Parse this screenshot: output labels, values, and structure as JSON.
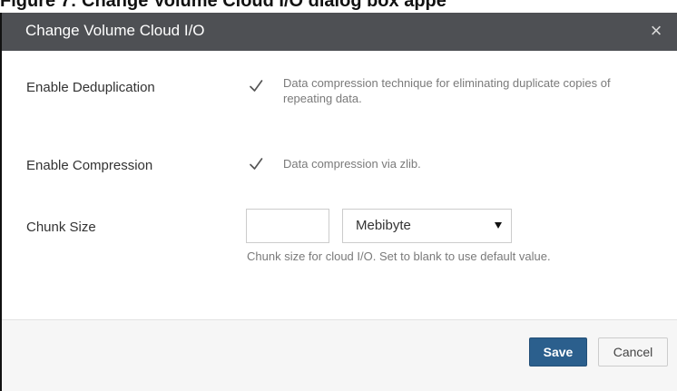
{
  "background_caption": "Figure 7: Change Volume Cloud I/O dialog box appe",
  "dialog": {
    "title": "Change Volume Cloud I/O",
    "close_symbol": "×"
  },
  "fields": {
    "deduplication": {
      "label": "Enable Deduplication",
      "checked": true,
      "help": "Data compression technique for eliminating duplicate copies of repeating data."
    },
    "compression": {
      "label": "Enable Compression",
      "checked": true,
      "help": "Data compression via zlib."
    },
    "chunk_size": {
      "label": "Chunk Size",
      "value": "",
      "unit": "Mebibyte",
      "help": "Chunk size for cloud I/O. Set to blank to use default value."
    }
  },
  "buttons": {
    "save": "Save",
    "cancel": "Cancel"
  },
  "colors": {
    "header_bg": "#4e5054",
    "primary_button": "#2b5f8d",
    "footer_bg": "#f6f6f6"
  },
  "icons": {
    "close": "close-icon",
    "checkbox": "checkmark-icon",
    "select_caret": "chevron-down-icon"
  }
}
